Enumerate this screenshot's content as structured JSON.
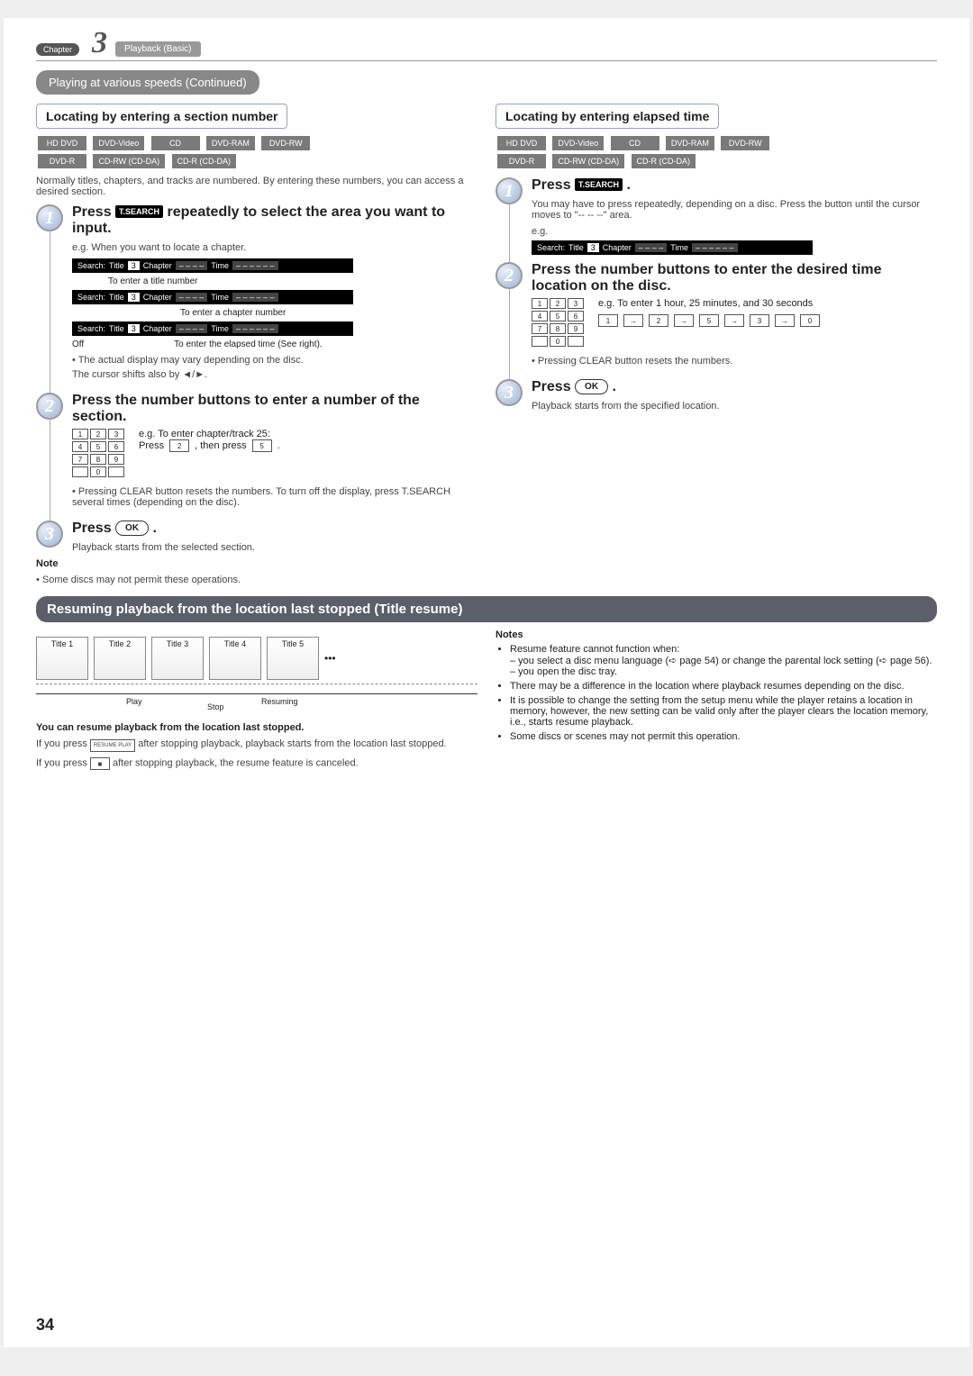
{
  "chapter": {
    "label": "Chapter",
    "num": "3",
    "title": "Playback (Basic)"
  },
  "topPill": "Playing at various speeds (Continued)",
  "formats": [
    "HD DVD",
    "DVD-Video",
    "CD",
    "DVD-RAM",
    "DVD-RW",
    "DVD-R",
    "CD-RW (CD-DA)",
    "CD-R (CD-DA)"
  ],
  "left": {
    "header": "Locating by entering a section number",
    "intro": "Normally titles, chapters, and tracks are numbered. By entering these numbers, you can access a desired section.",
    "step1": {
      "title_a": "Press ",
      "tsearch": "T.SEARCH",
      "title_b": " repeatedly to select the area you want to input.",
      "sub": "e.g. When you want to locate a chapter.",
      "bar_search": "Search:",
      "bar_title": "Title",
      "bar_num": "3",
      "bar_chapter": "Chapter",
      "bar_dash": "– – – –",
      "bar_time": "Time",
      "bar_time_dash": "– –  – –  – –",
      "cap_title": "To enter a title number",
      "cap_chap": "To enter a chapter number",
      "cap_time": "To enter the elapsed time (See right).",
      "off": "Off",
      "noteA": "• The actual display may vary depending on the disc.",
      "noteB": "The cursor shifts also by ◄/►."
    },
    "step2": {
      "title": "Press the number buttons to enter a number of the section.",
      "eg": "e.g. To enter chapter/track 25:",
      "press": "Press ",
      "then": ", then press ",
      "k2": "2",
      "k5": "5",
      "clear": "• Pressing CLEAR button resets the numbers. To turn off the display, press T.SEARCH several times (depending on the disc)."
    },
    "step3": {
      "title": "Press ",
      "ok": "OK",
      "end": "Playback starts from the selected section."
    },
    "note_h": "Note",
    "noteC": "• Some discs may not permit these operations."
  },
  "right": {
    "header": "Locating by entering elapsed time",
    "step1": {
      "title_a": "Press ",
      "tsearch": "T.SEARCH",
      "title_b": ".",
      "body": "You may have to press repeatedly, depending on a disc. Press the button until the cursor moves to \"-- -- --\" area.",
      "eg": "e.g."
    },
    "step2": {
      "title": "Press the number buttons to enter the desired time location on the disc.",
      "eg": "e.g. To enter 1 hour, 25 minutes, and 30 seconds",
      "seq": [
        "1",
        "2",
        "5",
        "3",
        "0"
      ],
      "clear": "• Pressing CLEAR button resets the numbers."
    },
    "step3": {
      "title": "Press ",
      "ok": "OK",
      "end": "Playback starts from the specified location."
    }
  },
  "resume": {
    "header": "Resuming playback from the location last stopped (Title resume)",
    "tiles": [
      "Title 1",
      "Title 2",
      "Title 3",
      "Title 4",
      "Title 5"
    ],
    "dots": "•••",
    "play": "Play",
    "stop": "Stop",
    "resuming": "Resuming",
    "lead": "You can resume playback from the location last stopped.",
    "p1a": "If you press ",
    "btn1": "RESUME PLAY",
    "p1b": " after stopping playback, playback starts from the location last stopped.",
    "p2a": "If you press ",
    "btn2": "■",
    "p2b": " after stopping playback, the resume feature is canceled.",
    "notes_h": "Notes",
    "n1": "Resume feature cannot function when:",
    "n1a": "– you select a disc menu language (➪ page 54) or change the parental lock setting (➪ page 56).",
    "n1b": "– you open the disc tray.",
    "n2": "There may be a difference in the location where playback resumes depending on the disc.",
    "n3": "It is possible to change the setting from the setup menu while the player retains a location in memory, however, the new setting can be valid only after the player clears the location memory, i.e., starts resume playback.",
    "n4": "Some discs or scenes may not permit this operation."
  },
  "pageNum": "34"
}
